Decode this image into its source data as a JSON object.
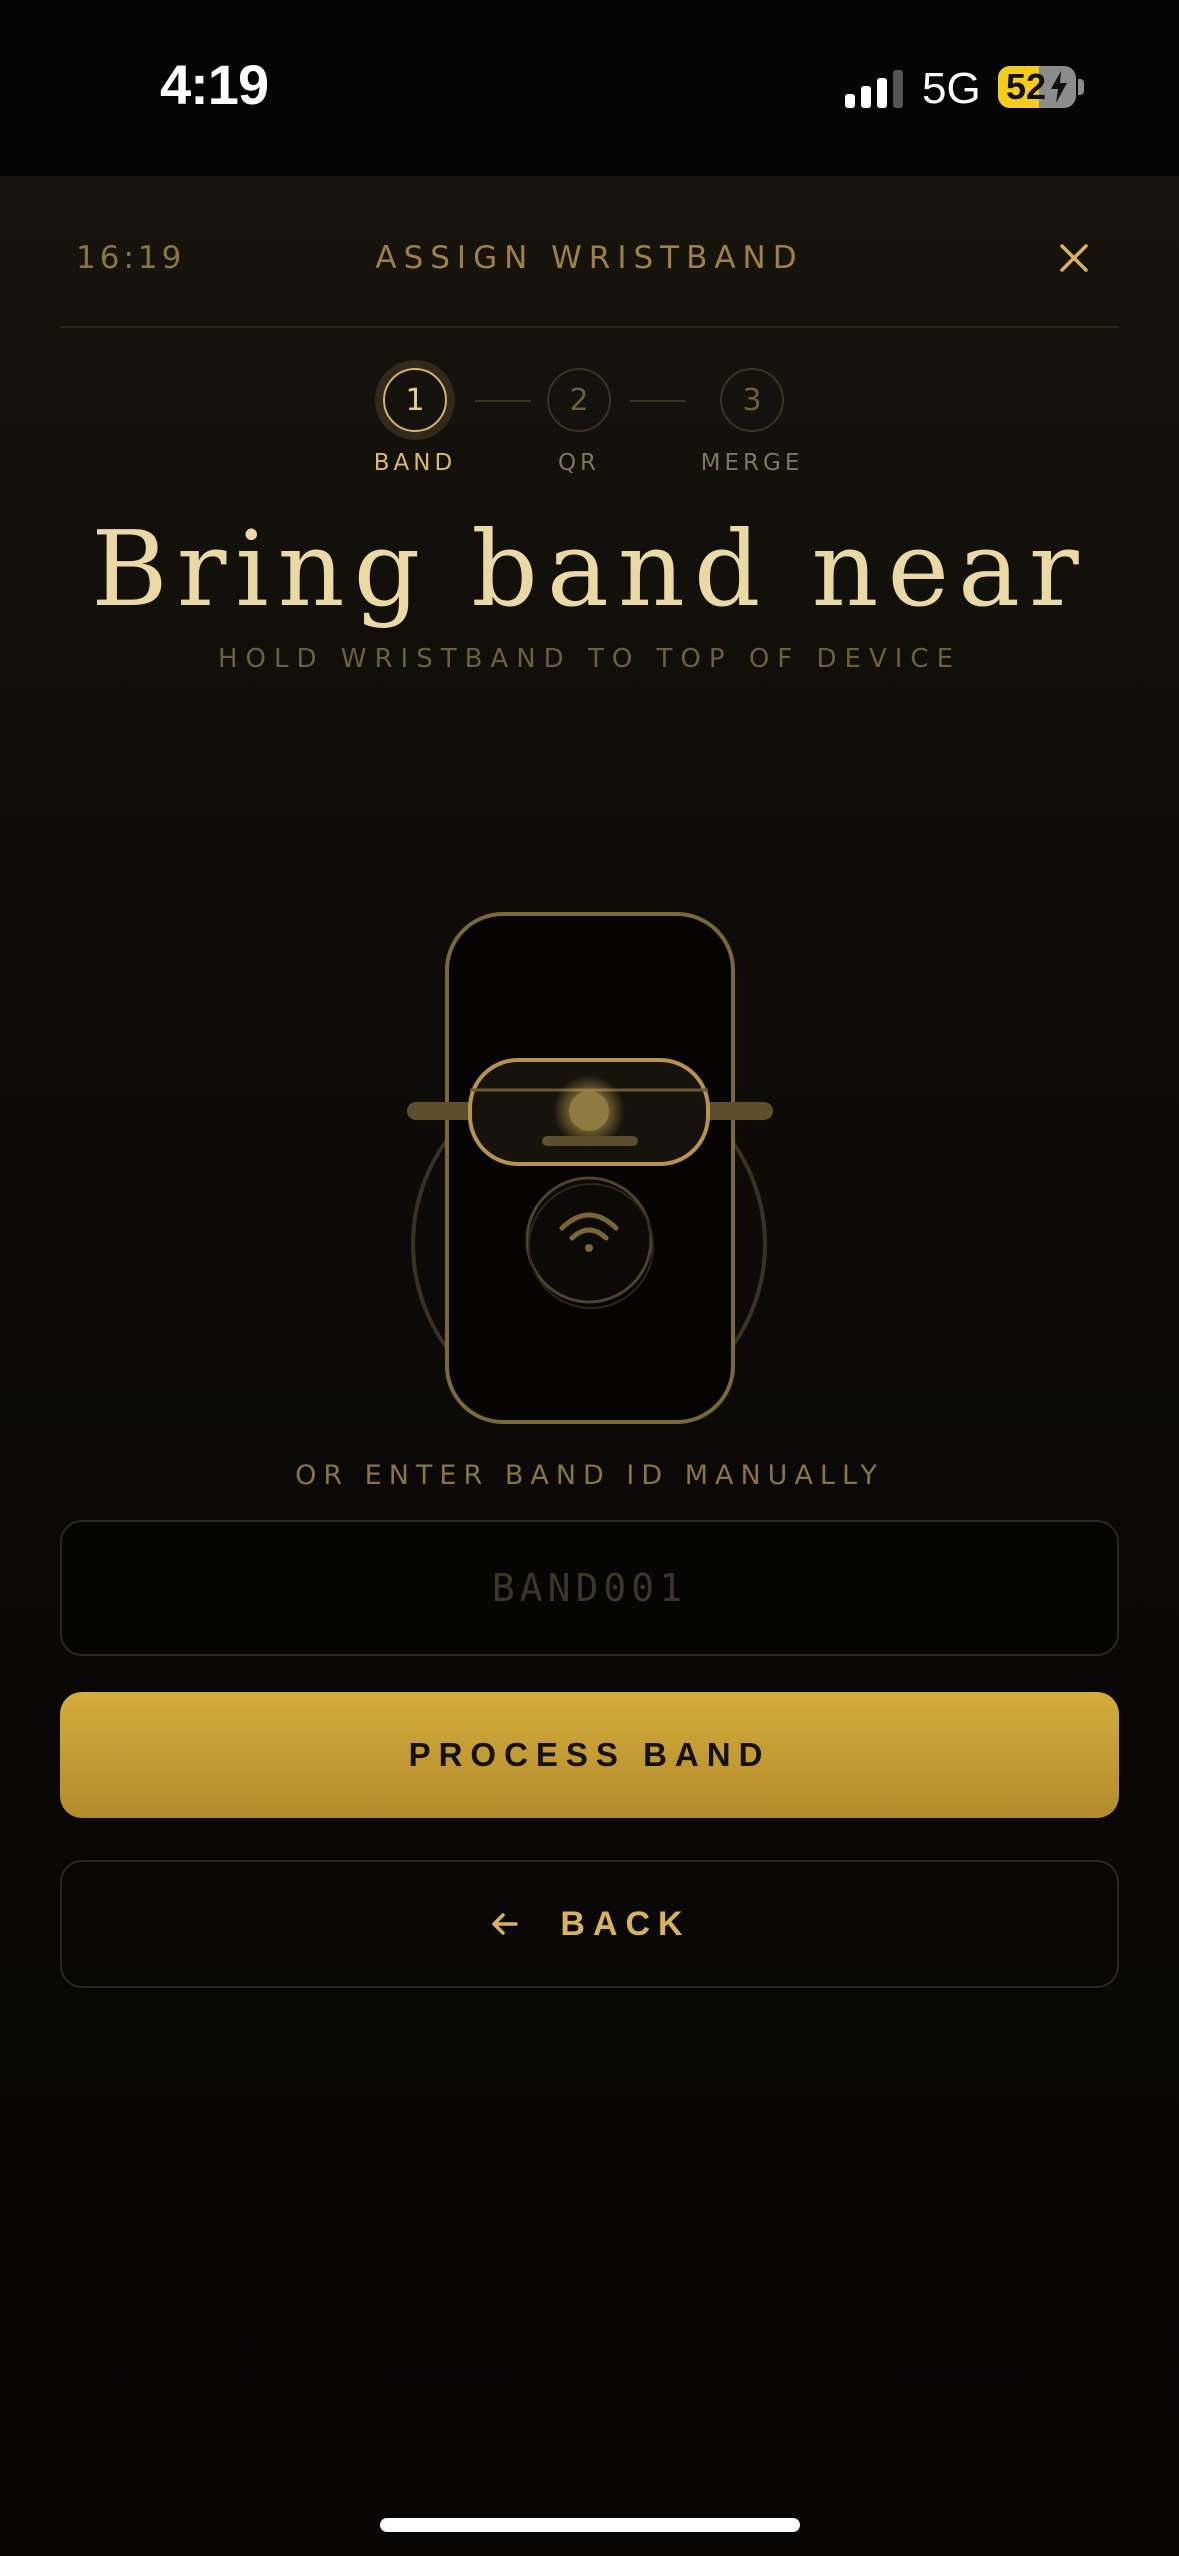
{
  "status_bar": {
    "time": "4:19",
    "network": "5G",
    "battery_percent": "52",
    "battery_level": 0.52,
    "signal_bars": 3
  },
  "header": {
    "time": "16:19",
    "title": "ASSIGN WRISTBAND",
    "close_icon": "close-icon"
  },
  "steps": [
    {
      "number": "1",
      "label": "BAND",
      "active": true
    },
    {
      "number": "2",
      "label": "QR",
      "active": false
    },
    {
      "number": "3",
      "label": "MERGE",
      "active": false
    }
  ],
  "main": {
    "headline": "Bring band near",
    "subline": "HOLD WRISTBAND TO TOP OF DEVICE",
    "illustration_icon": "nfc-phone-wristband-icon"
  },
  "manual": {
    "label": "OR ENTER BAND ID MANUALLY",
    "placeholder": "BAND001",
    "value": ""
  },
  "buttons": {
    "process_label": "PROCESS BAND",
    "back_label": "BACK"
  },
  "colors": {
    "accent": "#d4ad3c",
    "accent_light": "#ead9a4",
    "background": "#070605"
  }
}
